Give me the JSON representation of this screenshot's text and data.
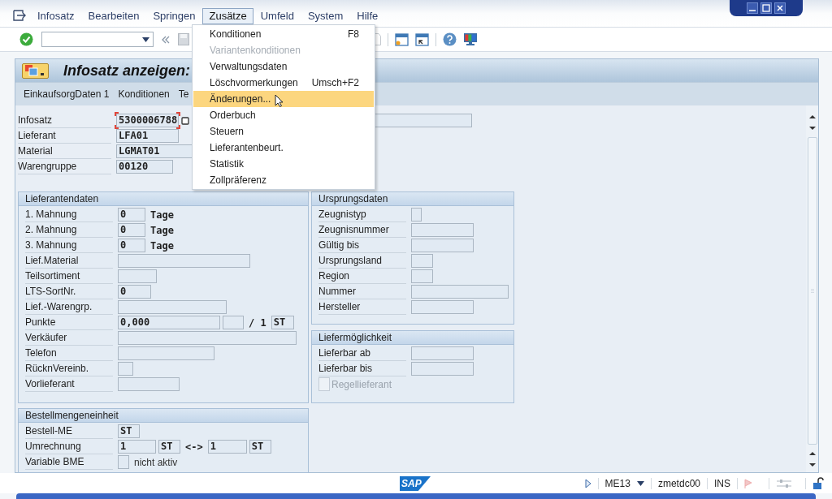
{
  "menu_bar": [
    {
      "label": "Infosatz",
      "selected": false
    },
    {
      "label": "Bearbeiten",
      "selected": false
    },
    {
      "label": "Springen",
      "selected": false
    },
    {
      "label": "Zusätze",
      "selected": true
    },
    {
      "label": "Umfeld",
      "selected": false
    },
    {
      "label": "System",
      "selected": false
    },
    {
      "label": "Hilfe",
      "selected": false
    }
  ],
  "dropdown": [
    {
      "label": "Konditionen",
      "shortcut": "F8",
      "disabled": false,
      "selected": false
    },
    {
      "label": "Variantenkonditionen",
      "disabled": true,
      "selected": false
    },
    {
      "label": "Verwaltungsdaten",
      "disabled": false,
      "selected": false
    },
    {
      "label": "Löschvormerkungen",
      "shortcut": "Umsch+F2",
      "disabled": false,
      "selected": false
    },
    {
      "label": "Änderungen...",
      "disabled": false,
      "selected": true
    },
    {
      "label": "Orderbuch",
      "disabled": false,
      "selected": false
    },
    {
      "label": "Steuern",
      "disabled": false,
      "selected": false
    },
    {
      "label": "Lieferantenbeurt.",
      "disabled": false,
      "selected": false
    },
    {
      "label": "Statistik",
      "disabled": false,
      "selected": false
    },
    {
      "label": "Zollpräferenz",
      "disabled": false,
      "selected": false
    }
  ],
  "screen_title": "Infosatz anzeigen:",
  "app_toolbar": [
    "EinkaufsorgDaten 1",
    "Konditionen",
    "Te"
  ],
  "header_fields": [
    {
      "label": "Infosatz",
      "fields": [
        {
          "kind": "input",
          "value": "5300006788",
          "focused": true
        },
        {
          "kind": "input"
        }
      ]
    },
    {
      "label": "Lieferant",
      "fields": [
        {
          "kind": "input",
          "value": "LFA01"
        }
      ]
    },
    {
      "label": "Material",
      "fields": [
        {
          "kind": "input",
          "value": "LGMAT01"
        }
      ]
    },
    {
      "label": "Warengruppe",
      "fields": [
        {
          "kind": "input",
          "value": "00120"
        }
      ]
    }
  ],
  "groups": [
    {
      "title": "Lieferantendaten",
      "rows": [
        {
          "label": "1. Mahnung",
          "fields": [
            {
              "kind": "input",
              "value": "0"
            },
            {
              "kind": "text",
              "value": "Tage"
            }
          ]
        },
        {
          "label": "2. Mahnung",
          "fields": [
            {
              "kind": "input",
              "value": "0"
            },
            {
              "kind": "text",
              "value": "Tage"
            }
          ]
        },
        {
          "label": "3. Mahnung",
          "fields": [
            {
              "kind": "input",
              "value": "0"
            },
            {
              "kind": "text",
              "value": "Tage"
            }
          ]
        },
        {
          "label": "Lief.Material",
          "fields": [
            {
              "kind": "input"
            }
          ]
        },
        {
          "label": "Teilsortiment",
          "fields": [
            {
              "kind": "input"
            }
          ]
        },
        {
          "label": "LTS-SortNr.",
          "fields": [
            {
              "kind": "input",
              "value": "0"
            }
          ]
        },
        {
          "label": "Lief.-Warengrp.",
          "fields": [
            {
              "kind": "input"
            }
          ]
        },
        {
          "label": "Punkte",
          "fields": [
            {
              "kind": "input",
              "value": "0,000"
            },
            {
              "kind": "input"
            },
            {
              "kind": "text",
              "value": "/ 1"
            },
            {
              "kind": "input",
              "value": "ST"
            }
          ]
        },
        {
          "label": "Verkäufer",
          "fields": [
            {
              "kind": "input"
            }
          ]
        },
        {
          "label": "Telefon",
          "fields": [
            {
              "kind": "input"
            }
          ]
        },
        {
          "label": "RücknVereinb.",
          "fields": [
            {
              "kind": "input"
            }
          ]
        },
        {
          "label": "Vorlieferant",
          "fields": [
            {
              "kind": "input"
            }
          ]
        }
      ]
    },
    {
      "title": "Ursprungsdaten",
      "rows": [
        {
          "label": "Zeugnistyp",
          "fields": [
            {
              "kind": "input"
            }
          ]
        },
        {
          "label": "Zeugnisnummer",
          "fields": [
            {
              "kind": "input"
            }
          ]
        },
        {
          "label": "Gültig bis",
          "fields": [
            {
              "kind": "input"
            }
          ]
        },
        {
          "label": "Ursprungsland",
          "fields": [
            {
              "kind": "input"
            }
          ]
        },
        {
          "label": "Region",
          "fields": [
            {
              "kind": "input"
            }
          ]
        },
        {
          "label": "Nummer",
          "fields": [
            {
              "kind": "input"
            }
          ]
        },
        {
          "label": "Hersteller",
          "fields": [
            {
              "kind": "input"
            }
          ]
        }
      ]
    },
    {
      "title": "Liefermöglichkeit",
      "rows": [
        {
          "label": "Lieferbar ab",
          "fields": [
            {
              "kind": "input"
            }
          ]
        },
        {
          "label": "Lieferbar bis",
          "fields": [
            {
              "kind": "input"
            }
          ]
        },
        {
          "fields": [
            {
              "kind": "checkbox",
              "label": "Regellieferant",
              "checked": false,
              "disabled": true
            }
          ]
        }
      ]
    },
    {
      "title": "Bestellmengeneinheit",
      "rows": [
        {
          "label": "Bestell-ME",
          "fields": [
            {
              "kind": "input",
              "value": "ST"
            }
          ]
        },
        {
          "label": "Umrechnung",
          "fields": [
            {
              "kind": "input",
              "value": "1"
            },
            {
              "kind": "input",
              "value": "ST"
            },
            {
              "kind": "text",
              "value": "<->"
            },
            {
              "kind": "input",
              "value": "1"
            },
            {
              "kind": "input",
              "value": "ST"
            }
          ]
        },
        {
          "label": "Variable BME",
          "fields": [
            {
              "kind": "checkbox",
              "checked": false,
              "disabled": false
            },
            {
              "kind": "plain",
              "value": "nicht aktiv"
            }
          ]
        }
      ]
    }
  ],
  "status_bar": {
    "logo": "SAP",
    "transaction": "ME13",
    "server": "zmetdc00",
    "mode": "INS"
  }
}
